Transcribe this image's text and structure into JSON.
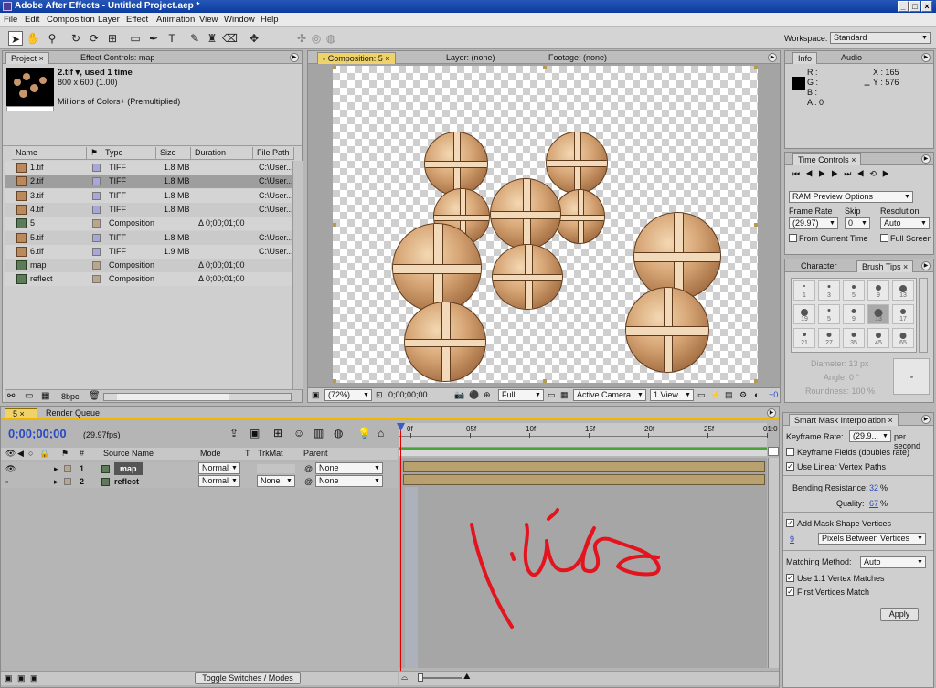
{
  "app": {
    "title": "Adobe After Effects - Untitled Project.aep *"
  },
  "menu": [
    "File",
    "Edit",
    "Composition",
    "Layer",
    "Effect",
    "Animation",
    "View",
    "Window",
    "Help"
  ],
  "workspace": {
    "label": "Workspace:",
    "value": "Standard"
  },
  "project_panel": {
    "tab": "Project",
    "tab2": "Effect Controls: map",
    "preview_name": "2.tif ▾, used 1 time",
    "preview_dims": "800 x 600 (1.00)",
    "preview_colors": "Millions of Colors+ (Premultiplied)",
    "headers": [
      "Name",
      "Type",
      "Size",
      "Duration",
      "File Path"
    ],
    "rows": [
      {
        "name": "1.tif",
        "type": "TIFF",
        "size": "1.8 MB",
        "duration": "",
        "path": "C:\\User...",
        "kind": "file",
        "color": "#a7a7d9"
      },
      {
        "name": "2.tif",
        "type": "TIFF",
        "size": "1.8 MB",
        "duration": "",
        "path": "C:\\User...",
        "kind": "file",
        "color": "#a7a7d9"
      },
      {
        "name": "3.tif",
        "type": "TIFF",
        "size": "1.8 MB",
        "duration": "",
        "path": "C:\\User...",
        "kind": "file",
        "color": "#a7a7d9"
      },
      {
        "name": "4.tif",
        "type": "TIFF",
        "size": "1.8 MB",
        "duration": "",
        "path": "C:\\User...",
        "kind": "file",
        "color": "#a7a7d9"
      },
      {
        "name": "5",
        "type": "Composition",
        "size": "",
        "duration": "Δ 0;00;01;00",
        "path": "",
        "kind": "comp",
        "color": "#bba68a"
      },
      {
        "name": "5.tif",
        "type": "TIFF",
        "size": "1.8 MB",
        "duration": "",
        "path": "C:\\User...",
        "kind": "file",
        "color": "#a7a7d9"
      },
      {
        "name": "6.tif",
        "type": "TIFF",
        "size": "1.9 MB",
        "duration": "",
        "path": "C:\\User...",
        "kind": "file",
        "color": "#a7a7d9"
      },
      {
        "name": "map",
        "type": "Composition",
        "size": "",
        "duration": "Δ 0;00;01;00",
        "path": "",
        "kind": "comp",
        "color": "#bba68a"
      },
      {
        "name": "reflect",
        "type": "Composition",
        "size": "",
        "duration": "Δ 0;00;01;00",
        "path": "",
        "kind": "comp",
        "color": "#bba68a"
      }
    ],
    "bpc": "8bpc"
  },
  "comp_panel": {
    "tab": "Composition: 5",
    "layer_tab": "Layer: (none)",
    "footage_tab": "Footage: (none)",
    "zoom": "(72%)",
    "timecode": "0;00;00;00",
    "resolution": "Full",
    "camera": "Active Camera",
    "view": "1 View",
    "offset": "+0"
  },
  "info": {
    "tab": "Info",
    "tab2": "Audio",
    "r": "R :",
    "g": "G :",
    "b": "B :",
    "a": "A : 0",
    "x": "X : 165",
    "y": "Y : 576"
  },
  "time_controls": {
    "title": "Time Controls",
    "preview_option": "RAM Preview Options",
    "frame_rate_label": "Frame Rate",
    "skip_label": "Skip",
    "resolution_label": "Resolution",
    "frame_rate": "(29.97)",
    "skip": "0",
    "resolution": "Auto",
    "from_current": "From Current Time",
    "full_screen": "Full Screen"
  },
  "brush_tips": {
    "tab1": "Character",
    "tab2": "Brush Tips",
    "sizes": [
      "1",
      "3",
      "5",
      "9",
      "13",
      "19",
      "5",
      "9",
      "13",
      "17",
      "21",
      "27",
      "35",
      "45",
      "65"
    ],
    "diameter": "Diameter: 13 px",
    "angle": "Angle: 0 °",
    "roundness": "Roundness: 100 %"
  },
  "timeline": {
    "tab": "5",
    "tab2": "Render Queue",
    "timecode": "0;00;00;00",
    "fps": "(29.97fps)",
    "headers": [
      "#",
      "Source Name",
      "Mode",
      "T",
      "TrkMat",
      "Parent"
    ],
    "layers": [
      {
        "num": "1",
        "name": "map",
        "mode": "Normal",
        "trkmat": "",
        "parent": "None"
      },
      {
        "num": "2",
        "name": "reflect",
        "mode": "Normal",
        "trkmat": "None",
        "parent": "None"
      }
    ],
    "ruler": [
      "0f",
      "05f",
      "10f",
      "15f",
      "20f",
      "25f",
      "01:0"
    ],
    "toggle": "Toggle Switches / Modes"
  },
  "smart_mask": {
    "title": "Smart Mask Interpolation",
    "keyframe_rate_label": "Keyframe Rate:",
    "keyframe_rate": "(29.9...",
    "per_second": "per second",
    "keyframe_fields": "Keyframe Fields (doubles rate)",
    "linear_vertex": "Use Linear Vertex Paths",
    "bending_label": "Bending Resistance:",
    "bending": "32",
    "quality_label": "Quality:",
    "quality": "67",
    "pct": "%",
    "add_vertices": "Add Mask Shape Vertices",
    "vertices_num": "9",
    "vertices_mode": "Pixels Between Vertices",
    "matching_label": "Matching Method:",
    "matching": "Auto",
    "one_to_one": "Use 1:1 Vertex Matches",
    "first_match": "First Vertices Match",
    "apply": "Apply"
  },
  "colors": {
    "accent": "#f1b600",
    "annotation": "#e3141e"
  }
}
